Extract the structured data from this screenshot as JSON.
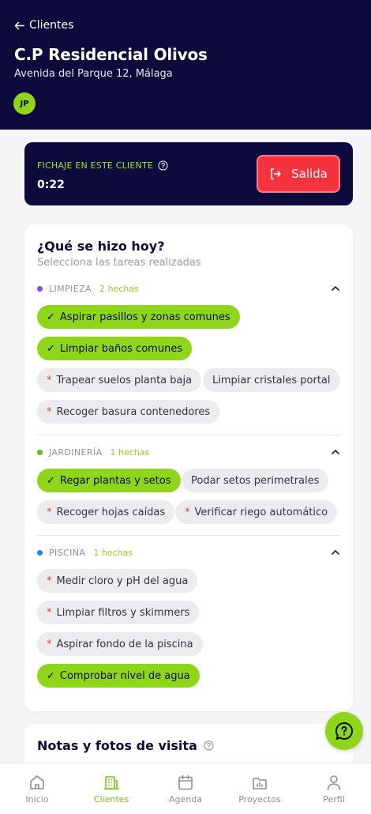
{
  "header": {
    "back_label": "Clientes",
    "client_name": "C.P Residencial Olivos",
    "client_address": "Avenida del Parque 12, Málaga",
    "avatar_initials": "JP"
  },
  "clock": {
    "label": "FICHAJE EN ESTE CLIENTE",
    "time": "0:22",
    "exit_label": "Salida"
  },
  "tasks": {
    "title": "¿Qué se hizo hoy?",
    "subtitle": "Selecciona las tareas realizadas",
    "sections": [
      {
        "name": "LIMPIEZA",
        "count": "2 hechas",
        "color": "#7c4dff",
        "tasks": [
          {
            "label": "Aspirar pasillos y zonas comunes",
            "done": true
          },
          {
            "label": "Limpiar baños comunes",
            "done": true
          },
          {
            "label": "Trapear suelos planta baja",
            "done": false,
            "required": true
          },
          {
            "label": "Limpiar cristales portal",
            "done": false,
            "required": false
          },
          {
            "label": "Recoger basura contenedores",
            "done": false,
            "required": true
          }
        ]
      },
      {
        "name": "JARDINERÍA",
        "count": "1 hechas",
        "color": "#5bbf1a",
        "tasks": [
          {
            "label": "Regar plantas y setos",
            "done": true
          },
          {
            "label": "Podar setos perimetrales",
            "done": false,
            "required": false
          },
          {
            "label": "Recoger hojas caídas",
            "done": false,
            "required": true
          },
          {
            "label": "Verificar riego automático",
            "done": false,
            "required": true
          }
        ]
      },
      {
        "name": "PISCINA",
        "count": "1 hechas",
        "color": "#1e88e5",
        "tasks": [
          {
            "label": "Medir cloro y pH del agua",
            "done": false,
            "required": true
          },
          {
            "label": "Limpiar filtros y skimmers",
            "done": false,
            "required": true
          },
          {
            "label": "Aspirar fondo de la piscina",
            "done": false,
            "required": true
          },
          {
            "label": "Comprobar nivel de agua",
            "done": true
          }
        ]
      }
    ]
  },
  "notes": {
    "title": "Notas y fotos de visita"
  },
  "nav": {
    "active": "Clientes",
    "items": [
      {
        "label": "Inicio",
        "icon": "home-icon"
      },
      {
        "label": "Clientes",
        "icon": "building-icon"
      },
      {
        "label": "Agenda",
        "icon": "calendar-icon"
      },
      {
        "label": "Proyectos",
        "icon": "chart-folder-icon"
      },
      {
        "label": "Perfil",
        "icon": "user-icon"
      }
    ]
  }
}
